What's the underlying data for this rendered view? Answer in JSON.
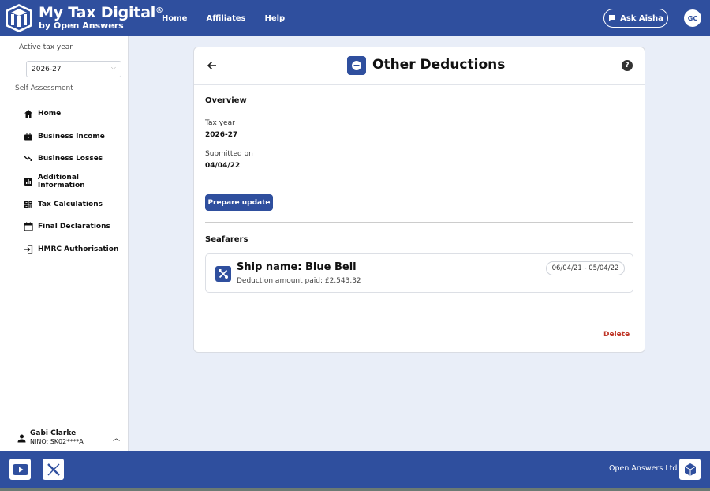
{
  "header": {
    "brand_title": "My Tax Digital",
    "brand_reg": "®",
    "brand_sub": "by Open Answers",
    "nav": [
      {
        "label": "Home"
      },
      {
        "label": "Affiliates"
      },
      {
        "label": "Help"
      }
    ],
    "ask_label": "Ask Aisha",
    "user_initials": "GC"
  },
  "sidebar": {
    "active_year_label": "Active tax year",
    "year_value": "2026-27",
    "section_label": "Self Assessment",
    "items": [
      {
        "label": "Home",
        "icon": "home-icon"
      },
      {
        "label": "Business Income",
        "icon": "briefcase-icon"
      },
      {
        "label": "Business Losses",
        "icon": "trending-down-icon"
      },
      {
        "label": "Additional Information",
        "icon": "bar-chart-icon"
      },
      {
        "label": "Tax Calculations",
        "icon": "calculator-icon"
      },
      {
        "label": "Final Declarations",
        "icon": "calendar-icon"
      },
      {
        "label": "HMRC Authorisation",
        "icon": "login-icon"
      }
    ],
    "user_name": "Gabi Clarke",
    "user_nino": "NINO: SK02****A"
  },
  "card": {
    "title": "Other Deductions",
    "overview_title": "Overview",
    "tax_year_label": "Tax year",
    "tax_year_value": "2026-27",
    "submitted_label": "Submitted on",
    "submitted_value": "04/04/22",
    "prepare_label": "Prepare update",
    "seafarers_title": "Seafarers",
    "seafarer": {
      "name": "Ship name: Blue Bell",
      "amount": "Deduction amount paid: £2,543.32",
      "dates": "06/04/21 - 05/04/22"
    },
    "delete_label": "Delete"
  },
  "footer": {
    "company": "Open Answers Ltd"
  },
  "colors": {
    "primary": "#2f4f9e",
    "background": "#e9eef8",
    "danger": "#c0392b"
  }
}
